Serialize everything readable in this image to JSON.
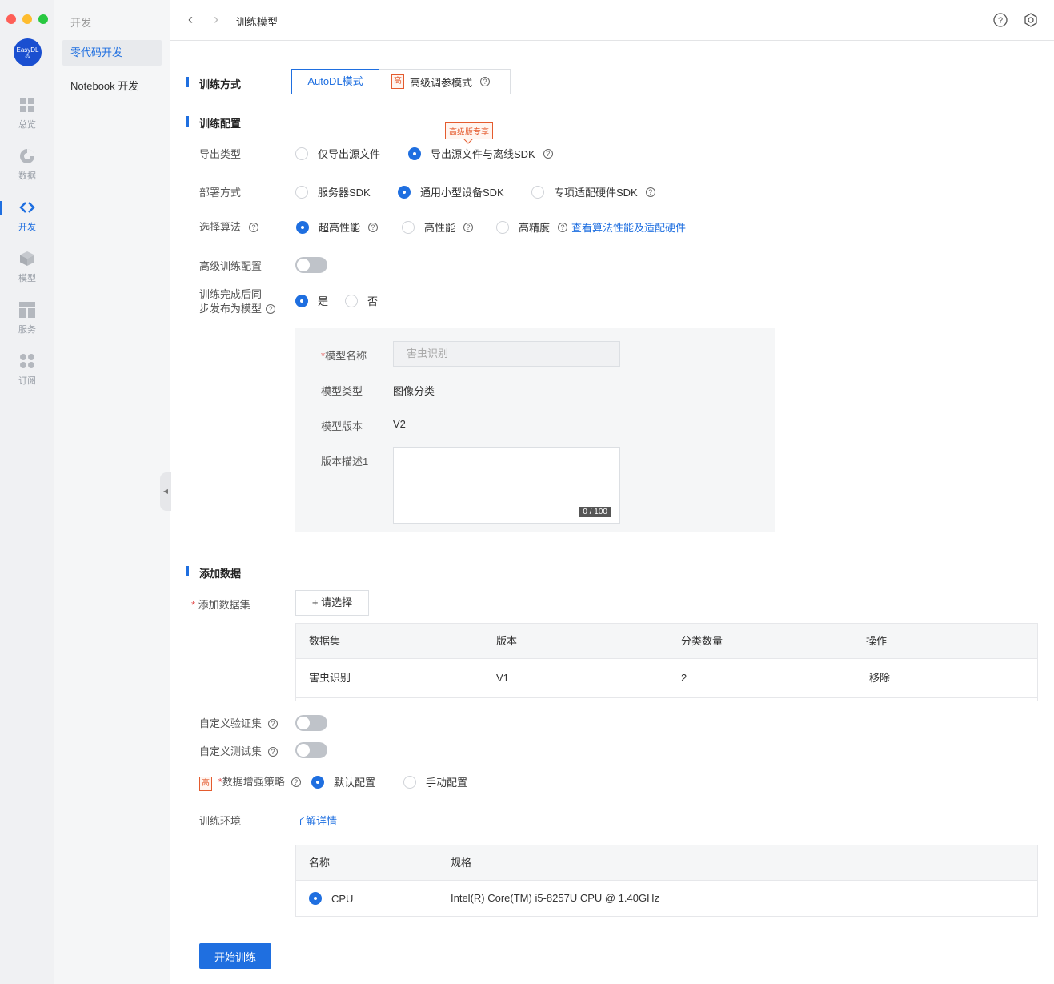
{
  "rail": {
    "logo_text": "EasyDL",
    "items": [
      {
        "label": "总览"
      },
      {
        "label": "数据"
      },
      {
        "label": "开发"
      },
      {
        "label": "模型"
      },
      {
        "label": "服务"
      },
      {
        "label": "订阅"
      }
    ]
  },
  "side": {
    "header": "开发",
    "items": [
      {
        "label": "零代码开发"
      },
      {
        "label": "Notebook 开发"
      }
    ]
  },
  "topbar": {
    "title": "训练模型"
  },
  "training_mode": {
    "title": "训练方式",
    "tab_autodl": "AutoDL模式",
    "tab_adv": "高级调参模式",
    "badge": "高"
  },
  "config": {
    "title": "训练配置",
    "export_label": "导出类型",
    "export_opt1": "仅导出源文件",
    "export_opt2": "导出源文件与离线SDK",
    "export_tip": "高级版专享",
    "deploy_label": "部署方式",
    "deploy_opt1": "服务器SDK",
    "deploy_opt2": "通用小型设备SDK",
    "deploy_opt3": "专项适配硬件SDK",
    "algo_label": "选择算法",
    "algo_opt1": "超高性能",
    "algo_opt2": "高性能",
    "algo_opt3": "高精度",
    "algo_link": "查看算法性能及适配硬件",
    "adv_label": "高级训练配置",
    "publish_label_1": "训练完成后同",
    "publish_label_2": "步发布为模型",
    "publish_yes": "是",
    "publish_no": "否"
  },
  "model": {
    "name_label": "模型名称",
    "name_value": "害虫识别",
    "type_label": "模型类型",
    "type_value": "图像分类",
    "version_label": "模型版本",
    "version_value": "V2",
    "desc_label": "版本描述1",
    "desc_count": "0 / 100"
  },
  "data": {
    "title": "添加数据",
    "dataset_label": "添加数据集",
    "add_button": "+ 请选择",
    "columns": [
      "数据集",
      "版本",
      "分类数量",
      "操作"
    ],
    "rows": [
      {
        "dataset": "害虫识别",
        "version": "V1",
        "count": "2",
        "action": "移除"
      }
    ],
    "val_label": "自定义验证集",
    "test_label": "自定义测试集",
    "aug_badge": "高",
    "aug_label": "数据增强策略",
    "aug_opt1": "默认配置",
    "aug_opt2": "手动配置"
  },
  "env": {
    "label": "训练环境",
    "link": "了解详情",
    "columns": [
      "名称",
      "规格"
    ],
    "rows": [
      {
        "name": "CPU",
        "spec": "Intel(R) Core(TM) i5-8257U CPU @ 1.40GHz"
      }
    ]
  },
  "start_button": "开始训练",
  "colors": {
    "accent": "#1f6fe0",
    "badge": "#e45b2e"
  }
}
